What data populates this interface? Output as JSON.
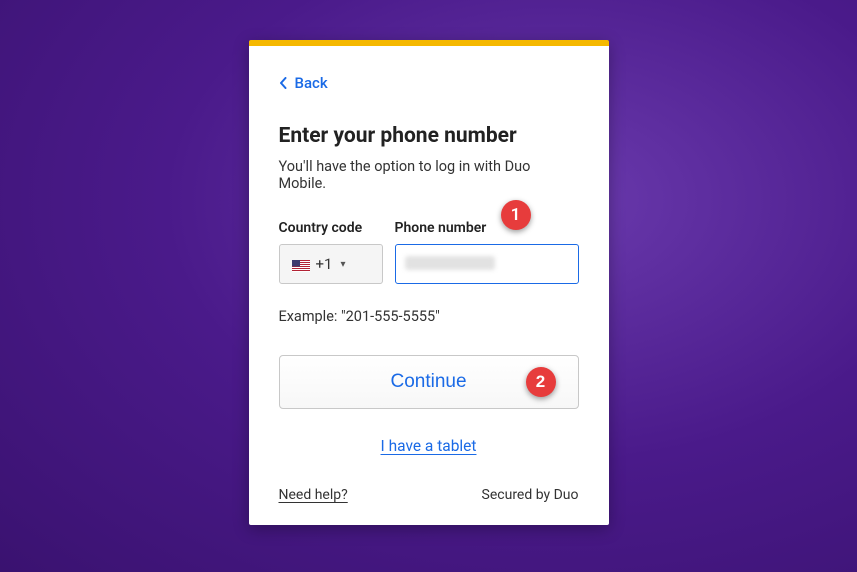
{
  "back": {
    "label": "Back"
  },
  "title": "Enter your phone number",
  "subtitle": "You'll have the option to log in with Duo Mobile.",
  "fields": {
    "country": {
      "label": "Country code",
      "value": "+1"
    },
    "phone": {
      "label": "Phone number",
      "placeholder": ""
    }
  },
  "example": "Example: \"201-555-5555\"",
  "continue_label": "Continue",
  "tablet_link": "I have a tablet",
  "help_link": "Need help?",
  "secured_text": "Secured by Duo",
  "callouts": {
    "1": "1",
    "2": "2"
  }
}
